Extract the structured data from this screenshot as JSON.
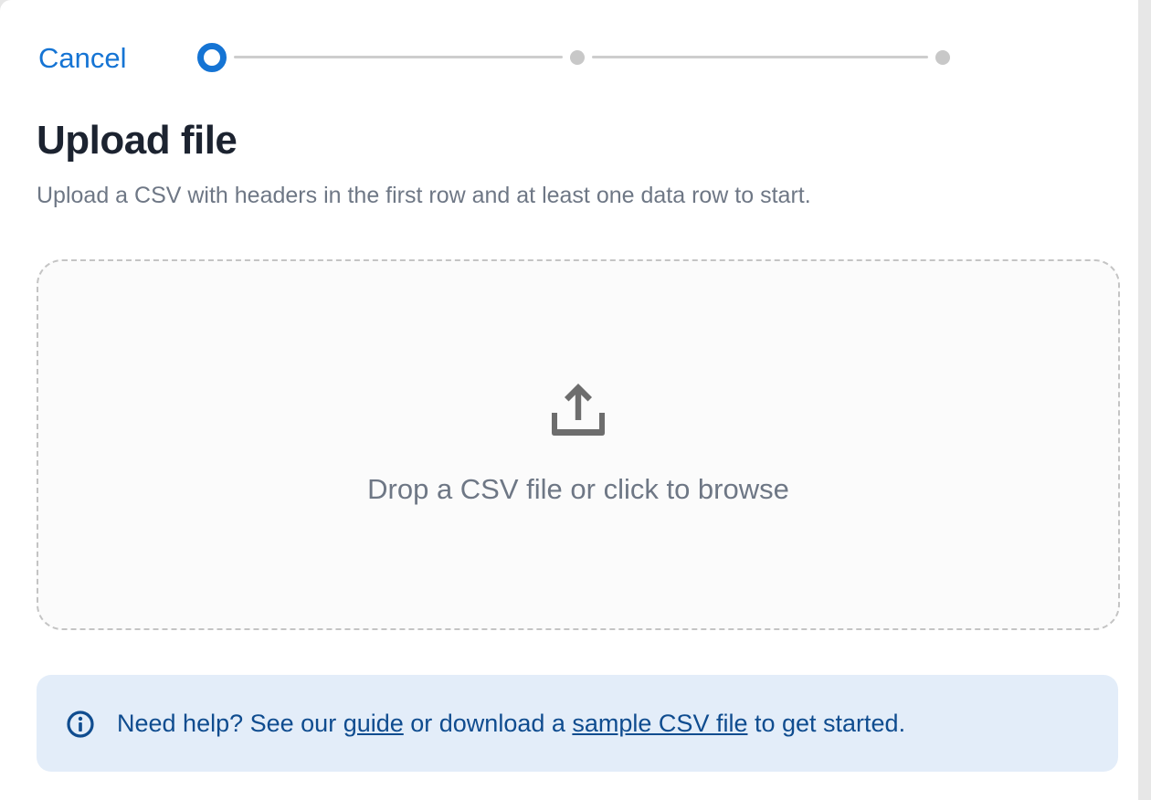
{
  "header": {
    "cancel_label": "Cancel"
  },
  "stepper": {
    "total_steps": 3,
    "current_step": 1
  },
  "page": {
    "title": "Upload file",
    "subtitle": "Upload a CSV with headers in the first row and at least one data row to start."
  },
  "dropzone": {
    "icon": "upload-icon",
    "label": "Drop a CSV file or click to browse"
  },
  "help": {
    "icon": "info-icon",
    "text_before": "Need help? See our ",
    "guide_link": "guide",
    "text_middle": " or download a ",
    "sample_link": "sample CSV file",
    "text_after": " to get started."
  },
  "colors": {
    "accent": "#1574d4",
    "title": "#1c2330",
    "muted_text": "#6e7785",
    "help_background": "#e3edf9",
    "help_text": "#0f4c8f"
  }
}
